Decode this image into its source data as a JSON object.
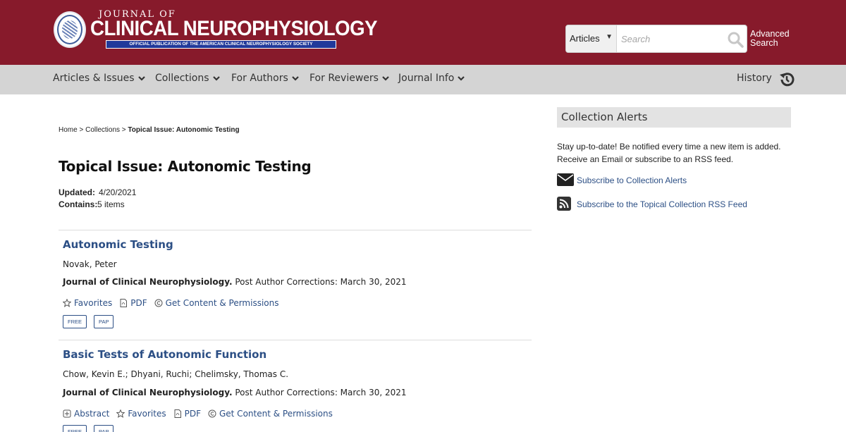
{
  "header": {
    "logo_top": "JOURNAL OF",
    "logo_main": "CLINICAL NEUROPHYSIOLOGY",
    "logo_sub": "OFFICIAL PUBLICATION OF THE AMERICAN CLINICAL NEUROPHYSIOLOGY SOCIETY",
    "search_scope": "Articles",
    "search_placeholder": "Search",
    "advanced_search": "Advanced Search",
    "background_color": "#871a2b"
  },
  "nav": {
    "items": [
      {
        "label": "Articles & Issues"
      },
      {
        "label": "Collections"
      },
      {
        "label": "For Authors"
      },
      {
        "label": "For Reviewers"
      },
      {
        "label": "Journal Info"
      }
    ],
    "history": "History"
  },
  "breadcrumb": {
    "home": "Home",
    "sep": ">",
    "collections": "Collections",
    "current": "Topical Issue: Autonomic Testing"
  },
  "page": {
    "title": "Topical Issue: Autonomic Testing",
    "updated_label": "Updated:",
    "updated_value": "4/20/2021",
    "contains_label": "Contains:",
    "contains_value": "5 items"
  },
  "articles": [
    {
      "title": "Autonomic Testing",
      "authors": "Novak, Peter",
      "journal": "Journal of Clinical Neurophysiology.",
      "status": "Post Author Corrections: March 30, 2021",
      "actions": {
        "favorites": "Favorites",
        "pdf": "PDF",
        "permissions": "Get Content & Permissions"
      },
      "badges": [
        "FREE",
        "PAP"
      ]
    },
    {
      "title": "Basic Tests of Autonomic Function",
      "authors": "Chow, Kevin E.; Dhyani, Ruchi; Chelimsky, Thomas C.",
      "journal": "Journal of Clinical Neurophysiology.",
      "status": "Post Author Corrections: March 30, 2021",
      "actions": {
        "abstract": "Abstract",
        "favorites": "Favorites",
        "pdf": "PDF",
        "permissions": "Get Content & Permissions"
      },
      "badges": [
        "FREE",
        "PAP"
      ]
    }
  ],
  "sidebar": {
    "heading": "Collection Alerts",
    "description": "Stay up-to-date! Be notified every time a new item is added. Receive an Email or subscribe to an RSS feed.",
    "email_link": "Subscribe to Collection Alerts",
    "rss_link": "Subscribe to the Topical Collection RSS Feed"
  },
  "colors": {
    "link": "#2c4f85",
    "nav_bg": "#d4d4d4"
  }
}
